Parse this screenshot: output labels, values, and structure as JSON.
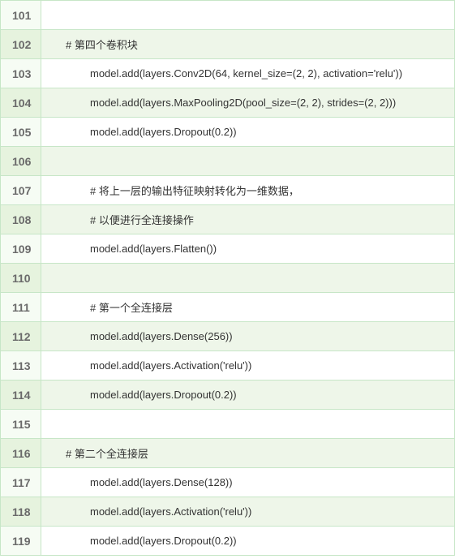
{
  "lines": [
    {
      "num": "101",
      "code": "",
      "hl": false
    },
    {
      "num": "102",
      "code": "# 第四个卷积块",
      "hl": true
    },
    {
      "num": "103",
      "code": "model.add(layers.Conv2D(64, kernel_size=(2, 2), activation='relu'))",
      "hl": false
    },
    {
      "num": "104",
      "code": "model.add(layers.MaxPooling2D(pool_size=(2, 2), strides=(2, 2)))",
      "hl": true
    },
    {
      "num": "105",
      "code": "model.add(layers.Dropout(0.2))",
      "hl": false
    },
    {
      "num": "106",
      "code": "",
      "hl": true
    },
    {
      "num": "107",
      "code": "# 将上一层的输出特征映射转化为一维数据，",
      "hl": false
    },
    {
      "num": "108",
      "code": "# 以便进行全连接操作",
      "hl": true
    },
    {
      "num": "109",
      "code": "model.add(layers.Flatten())",
      "hl": false
    },
    {
      "num": "110",
      "code": "",
      "hl": true
    },
    {
      "num": "111",
      "code": "# 第一个全连接层",
      "hl": false
    },
    {
      "num": "112",
      "code": "model.add(layers.Dense(256))",
      "hl": true
    },
    {
      "num": "113",
      "code": "model.add(layers.Activation('relu'))",
      "hl": false
    },
    {
      "num": "114",
      "code": "model.add(layers.Dropout(0.2))",
      "hl": true
    },
    {
      "num": "115",
      "code": "",
      "hl": false
    },
    {
      "num": "116",
      "code": "# 第二个全连接层",
      "hl": true
    },
    {
      "num": "117",
      "code": "model.add(layers.Dense(128))",
      "hl": false
    },
    {
      "num": "118",
      "code": "model.add(layers.Activation('relu'))",
      "hl": true
    },
    {
      "num": "119",
      "code": "model.add(layers.Dropout(0.2))",
      "hl": false
    }
  ]
}
